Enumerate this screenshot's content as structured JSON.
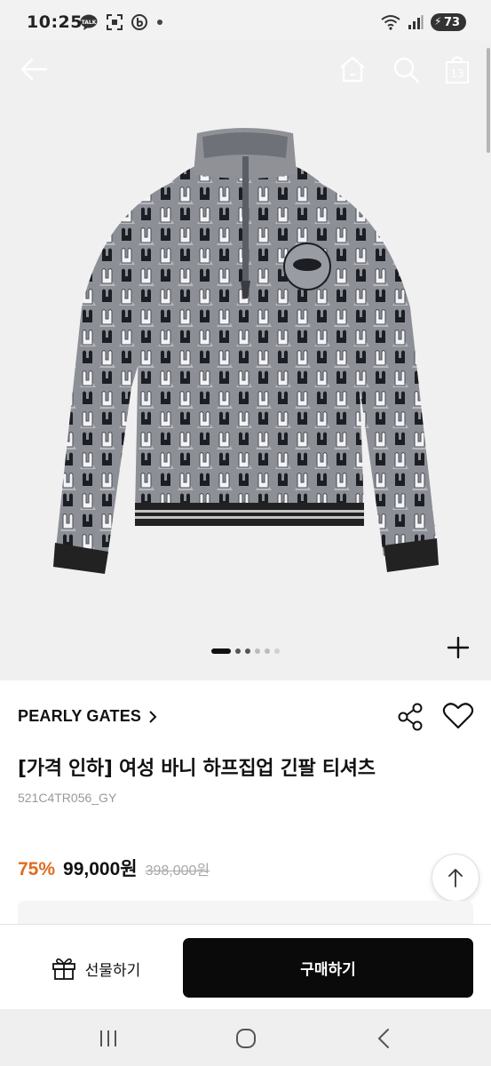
{
  "status_bar": {
    "time": "10:25",
    "battery_level": "73",
    "icons": [
      "talk-icon",
      "scan-icon",
      "b-app-icon",
      "dot-icon",
      "wifi-icon",
      "signal-icon",
      "battery-icon"
    ]
  },
  "header": {
    "cart_count": "13",
    "icons": [
      "back-arrow-icon",
      "home-icon",
      "search-icon",
      "shopping-bag-icon"
    ]
  },
  "gallery": {
    "page_count": 6,
    "current_page": 1
  },
  "product": {
    "brand": "PEARLY GATES",
    "title": "[가격 인하] 여성 바니 하프집업 긴팔 티셔츠",
    "code": "521C4TR056_GY",
    "discount": "75%",
    "price": "99,000원",
    "original_price": "398,000원"
  },
  "actions": {
    "gift_label": "선물하기",
    "buy_label": "구매하기"
  },
  "colors": {
    "discount": "#e06b21",
    "buy_button_bg": "#0a0a0a",
    "image_bg": "#f0f0f0"
  }
}
